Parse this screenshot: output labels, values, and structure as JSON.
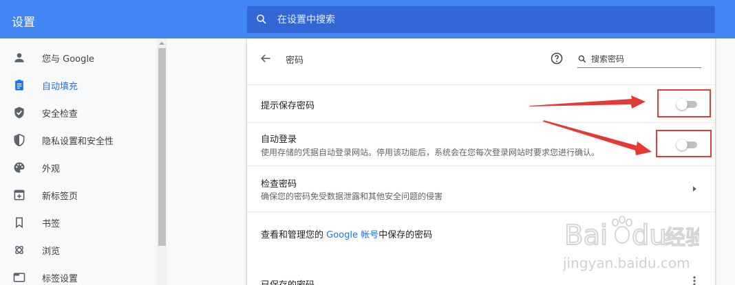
{
  "header": {
    "title": "设置",
    "search_placeholder": "在设置中搜索"
  },
  "sidebar": {
    "items": [
      {
        "label": "您与 Google",
        "icon": "person-icon",
        "active": false
      },
      {
        "label": "自动填充",
        "icon": "clipboard-icon",
        "active": true
      },
      {
        "label": "安全检查",
        "icon": "shield-check-icon",
        "active": false
      },
      {
        "label": "隐私设置和安全性",
        "icon": "shield-half-icon",
        "active": false
      },
      {
        "label": "外观",
        "icon": "palette-icon",
        "active": false
      },
      {
        "label": "新标签页",
        "icon": "new-tab-icon",
        "active": false
      },
      {
        "label": "书签",
        "icon": "bookmark-icon",
        "active": false
      },
      {
        "label": "浏览",
        "icon": "browse-icon",
        "active": false
      },
      {
        "label": "标签设置",
        "icon": "tab-icon",
        "active": false
      }
    ]
  },
  "main": {
    "title": "密码",
    "search_placeholder": "搜索密码",
    "rows": {
      "offer_to_save": {
        "title": "提示保存密码",
        "enabled": false
      },
      "auto_signin": {
        "title": "自动登录",
        "subtitle": "使用存储的凭据自动登录网站。停用该功能后，系统会在您每次登录网站时要求您进行确认。",
        "enabled": false
      },
      "check_passwords": {
        "title": "检查密码",
        "subtitle": "确保您的密码免受数据泄露和其他安全问题的侵害"
      },
      "manage": {
        "prefix": "查看和管理您的 ",
        "link": "Google 帐号",
        "suffix": "中保存的密码"
      },
      "saved": {
        "title": "已保存的密码"
      }
    }
  },
  "watermark": {
    "logo": "Baidu 经验",
    "url": "jingyan.baidu.com"
  },
  "colors": {
    "header": "#4285f4",
    "search_bg": "#3367d6",
    "accent": "#1a73e8",
    "annotation": "#e53935"
  }
}
